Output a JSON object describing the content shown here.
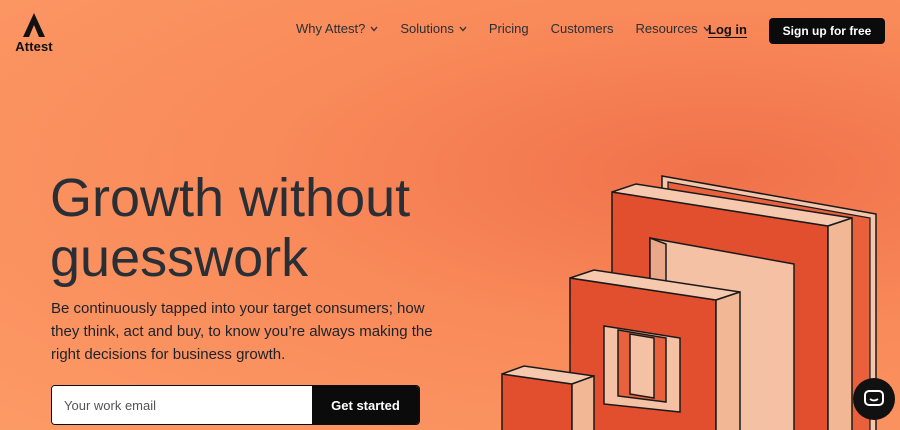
{
  "brand": {
    "name": "Attest"
  },
  "nav": {
    "items": [
      {
        "label": "Why Attest?",
        "has_dropdown": true
      },
      {
        "label": "Solutions",
        "has_dropdown": true
      },
      {
        "label": "Pricing",
        "has_dropdown": false
      },
      {
        "label": "Customers",
        "has_dropdown": false
      },
      {
        "label": "Resources",
        "has_dropdown": true
      }
    ],
    "login_label": "Log in",
    "signup_label": "Sign up for free"
  },
  "hero": {
    "headline_line1": "Growth without",
    "headline_line2": "guesswork",
    "subtext": "Be continuously tapped into your target consumers; how they think, act and buy, to know you’re always making the right decisions for business growth.",
    "email_placeholder": "Your work email",
    "cta_label": "Get started"
  },
  "icons": {
    "logo": "attest-triangle-logo",
    "dropdown": "chevron-down-icon",
    "chat": "chat-bubble-icon"
  },
  "colors": {
    "background": "#fc9a66",
    "accent": "#e24f2e",
    "button": "#0b0b0b"
  }
}
